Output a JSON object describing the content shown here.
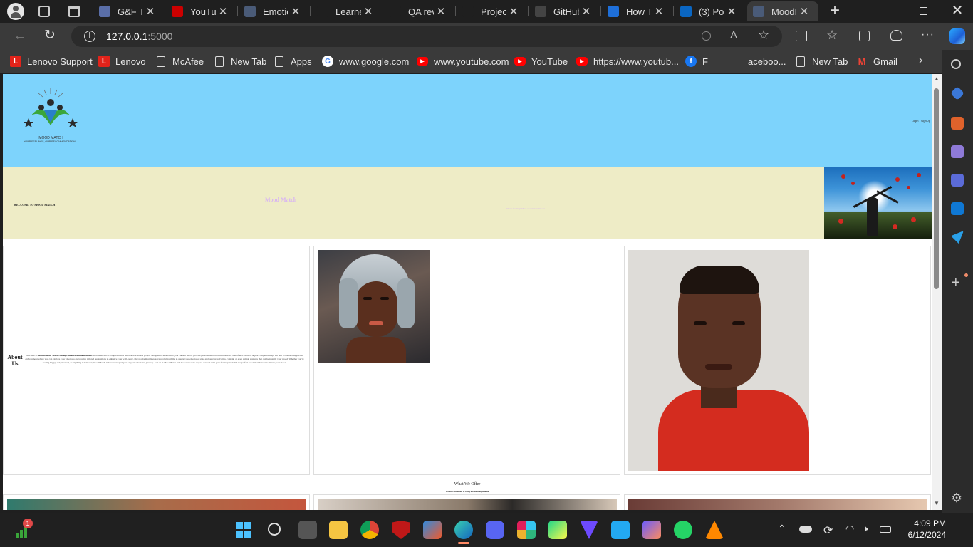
{
  "browser": {
    "tabs": [
      {
        "label": "G&F Te",
        "icon": "tab-doc-icon",
        "color": "#5a6ea8"
      },
      {
        "label": "YouTul",
        "icon": "youtube-icon",
        "color": "#cc0000"
      },
      {
        "label": "Emotio",
        "icon": "terminal-icon",
        "color": "#4a5b78"
      },
      {
        "label": "Learne",
        "icon": "",
        "color": "#1f1f1f"
      },
      {
        "label": "QA rev",
        "icon": "",
        "color": "#1f1f1f"
      },
      {
        "label": "Project",
        "icon": "",
        "color": "#1f1f1f"
      },
      {
        "label": "GitHub",
        "icon": "github-icon",
        "color": "#444444"
      },
      {
        "label": "How To",
        "icon": "loading-icon",
        "color": "#1e6fd9"
      },
      {
        "label": "(3) Pos",
        "icon": "linkedin-icon",
        "color": "#0a66c2"
      },
      {
        "label": "MoodI",
        "icon": "terminal-icon",
        "color": "#4a5b78"
      }
    ],
    "url_host": "127.0.0.1",
    "url_port": ":5000",
    "favorites": [
      {
        "label": "Lenovo Support",
        "icon": "L",
        "color": "#e2231a"
      },
      {
        "label": "Lenovo",
        "icon": "L",
        "color": "#e2231a"
      },
      {
        "label": "McAfee",
        "icon": "page",
        "color": "#3a3a3a"
      },
      {
        "label": "New Tab",
        "icon": "page",
        "color": "#3a3a3a"
      },
      {
        "label": "Apps",
        "icon": "page",
        "color": "#3a3a3a"
      },
      {
        "label": "www.google.com",
        "icon": "G",
        "color": "#ffffff"
      },
      {
        "label": "www.youtube.com",
        "icon": "yt",
        "color": "#ff0000"
      },
      {
        "label": "YouTube",
        "icon": "yt",
        "color": "#ff0000"
      },
      {
        "label": "https://www.youtub...",
        "icon": "yt",
        "color": "#ff0000"
      },
      {
        "label": "F",
        "icon": "f",
        "color": "#1877f2"
      },
      {
        "label": "aceboo...",
        "icon": "",
        "color": "#3a3a3a"
      },
      {
        "label": "New Tab",
        "icon": "page",
        "color": "#3a3a3a"
      },
      {
        "label": "Gmail",
        "icon": "M",
        "color": "#ffffff"
      }
    ]
  },
  "site": {
    "logo_text": "MOOD MATCH",
    "logo_tagline": "YOUR FEELINGS, OUR RECOMMENDATION",
    "nav_login": "Login",
    "nav_signup": "SignUp",
    "hero_welcome": "WELCOME TO MOOD MATCH",
    "hero_title": "Mood Match",
    "hero_subtitle": "Where feelings Meet recommendations",
    "about_heading": "About Us",
    "about_text_intro": "Welcome to ",
    "about_text_bold": "MoodMatch: Where feelings meet recommendations.",
    "about_text_body": " MoodMatch is a comprehensive emotional wellness project designed to understand your current mood, provide personalized recommendations, and offer a touch of digital companionship. We aim to create a supportive environment where you can explore your emotions and receive tailored suggestions to enhance your well-being. Our platform utilizes advanced algorithms to gauge your emotional state and suggest activities, content, or even simple gestures that can help uplift your mood. Whether you're feeling happy, sad, stressed, or anything in between, MoodMatch is here to support you on your emotional journey. Join us at MoodMatch and discover a new way to connect with your feelings and find the perfect recommendations to match your mood.",
    "offer_title": "What We Offer",
    "offer_subtitle": "We are committed to bring excellent experience"
  },
  "taskbar": {
    "time": "4:09 PM",
    "date": "6/12/2024",
    "badge": "1"
  }
}
